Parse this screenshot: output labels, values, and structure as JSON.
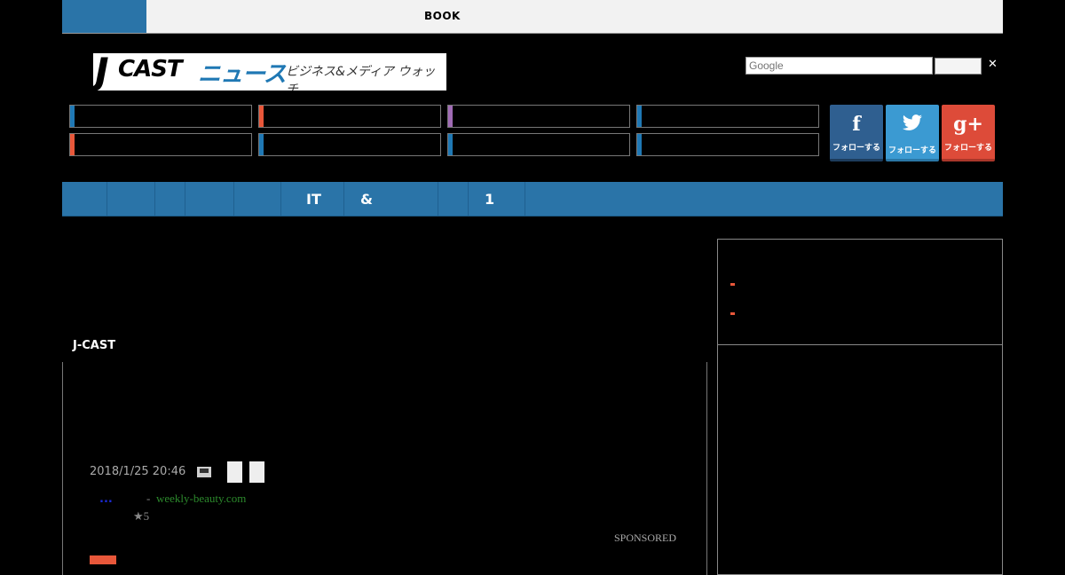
{
  "topbar": {
    "book_label": "BOOK"
  },
  "logo": {
    "mark": "J",
    "cast": "CAST",
    "news": "ニュース",
    "tagline": "ビジネス&メディア ウォッチ"
  },
  "search": {
    "placeholder": "Google",
    "button_label": "",
    "close_glyph": "✕"
  },
  "categories": [
    {
      "color": "#1f78b4"
    },
    {
      "color": "#e8573a"
    },
    {
      "color": "#a06bb5"
    },
    {
      "color": "#1f78b4"
    },
    {
      "color": "#e8573a"
    },
    {
      "color": "#1f78b4"
    },
    {
      "color": "#1f78b4"
    },
    {
      "color": "#1f78b4"
    }
  ],
  "social": {
    "facebook": {
      "glyph": "f",
      "label": "フォローする",
      "icon": "facebook-icon"
    },
    "twitter": {
      "glyph": "🐦",
      "label": "フォローする",
      "icon": "twitter-icon"
    },
    "googleplus": {
      "glyph": "g+",
      "label": "フォローする",
      "icon": "google-plus-icon"
    }
  },
  "nav": {
    "items": [
      "IT",
      "&",
      "1"
    ]
  },
  "main": {
    "section_label": "J-CAST",
    "date": "2018/1/25 20:46",
    "dots": "...",
    "source_sep": "-",
    "source": "weekly-beauty.com",
    "rating": "★5",
    "sponsored": "SPONSORED"
  },
  "colors": {
    "accent": "#2a74a8",
    "red": "#e8573a",
    "purple": "#a06bb5"
  }
}
